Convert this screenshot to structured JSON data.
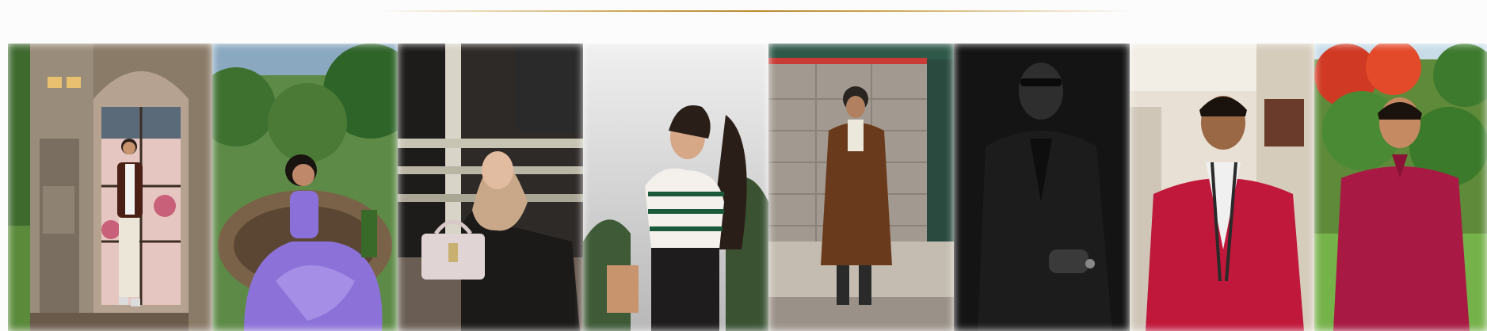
{
  "gallery": {
    "divider_color": "#c9a24a",
    "photos": [
      {
        "subject": "man-white-shirt-arched-doorway",
        "dominant": "#7c6a5a"
      },
      {
        "subject": "woman-purple-dress-nest",
        "dominant": "#6a8a4a"
      },
      {
        "subject": "woman-hijab-cafe-handbag",
        "dominant": "#3a3632"
      },
      {
        "subject": "woman-striped-top-clouds",
        "dominant": "#d4d4d4"
      },
      {
        "subject": "man-brown-coat-brick-wall",
        "dominant": "#9a928a"
      },
      {
        "subject": "man-black-suit-monochrome",
        "dominant": "#1a1a1a"
      },
      {
        "subject": "man-red-blazer-lanyard",
        "dominant": "#b01838"
      },
      {
        "subject": "man-red-shirt-garden",
        "dominant": "#9a1a40"
      }
    ]
  }
}
